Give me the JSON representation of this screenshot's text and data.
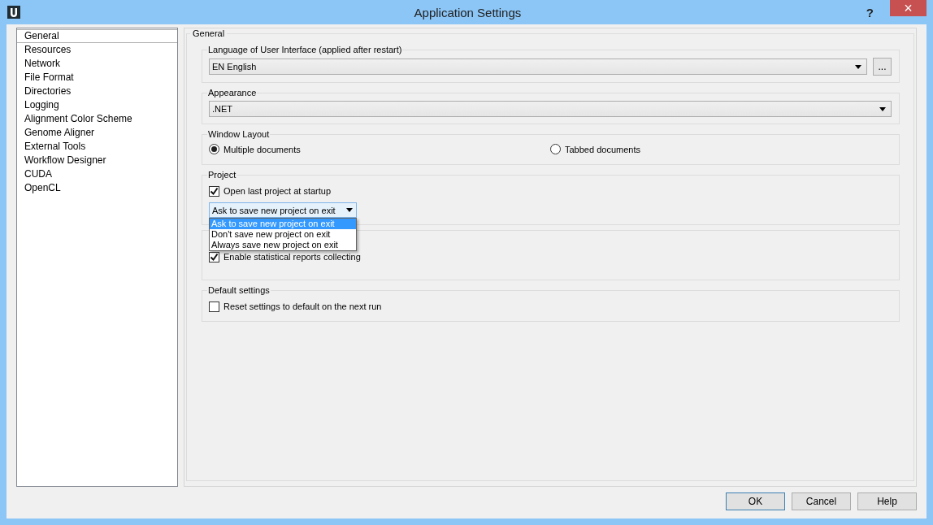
{
  "window": {
    "title": "Application Settings",
    "help_glyph": "?",
    "close_glyph": "×"
  },
  "sidebar": {
    "items": [
      {
        "label": "General",
        "selected": true
      },
      {
        "label": "Resources",
        "selected": false
      },
      {
        "label": "Network",
        "selected": false
      },
      {
        "label": "File Format",
        "selected": false
      },
      {
        "label": "Directories",
        "selected": false
      },
      {
        "label": "Logging",
        "selected": false
      },
      {
        "label": "Alignment Color Scheme",
        "selected": false
      },
      {
        "label": "Genome Aligner",
        "selected": false
      },
      {
        "label": "External Tools",
        "selected": false
      },
      {
        "label": "Workflow Designer",
        "selected": false
      },
      {
        "label": "CUDA",
        "selected": false
      },
      {
        "label": "OpenCL",
        "selected": false
      }
    ]
  },
  "panel": {
    "title": "General",
    "groups": [
      {
        "title": "Language of User Interface (applied after restart)",
        "controls": [
          {
            "kind": "select",
            "value": "EN English",
            "button": "..."
          }
        ]
      },
      {
        "title": "Appearance",
        "controls": [
          {
            "kind": "select",
            "value": ".NET"
          }
        ]
      },
      {
        "title": "Window Layout",
        "controls": [
          {
            "kind": "radios",
            "options": [
              {
                "label": "Multiple documents",
                "selected": true
              },
              {
                "label": "Tabbed documents",
                "selected": false
              }
            ]
          }
        ]
      },
      {
        "title": "Project",
        "controls": [
          {
            "kind": "checkbox",
            "label": "Open last project at startup",
            "checked": true
          },
          {
            "kind": "dropdown",
            "value": "Ask to save new project on exit",
            "open": true,
            "options": [
              {
                "label": "Ask to save new project on exit",
                "selected": true
              },
              {
                "label": "Don't save new project on exit",
                "selected": false
              },
              {
                "label": "Always save new project on exit",
                "selected": false
              }
            ]
          }
        ]
      },
      {
        "controls": [
          {
            "kind": "checkbox",
            "label": "Enable statistical reports collecting",
            "checked": true
          }
        ]
      },
      {
        "title": "Default settings",
        "controls": [
          {
            "kind": "checkbox",
            "label": "Reset settings to default on the next run",
            "checked": false
          }
        ]
      }
    ]
  },
  "buttons": [
    {
      "label": "OK",
      "default": true
    },
    {
      "label": "Cancel",
      "default": false
    },
    {
      "label": "Help",
      "default": false
    }
  ]
}
